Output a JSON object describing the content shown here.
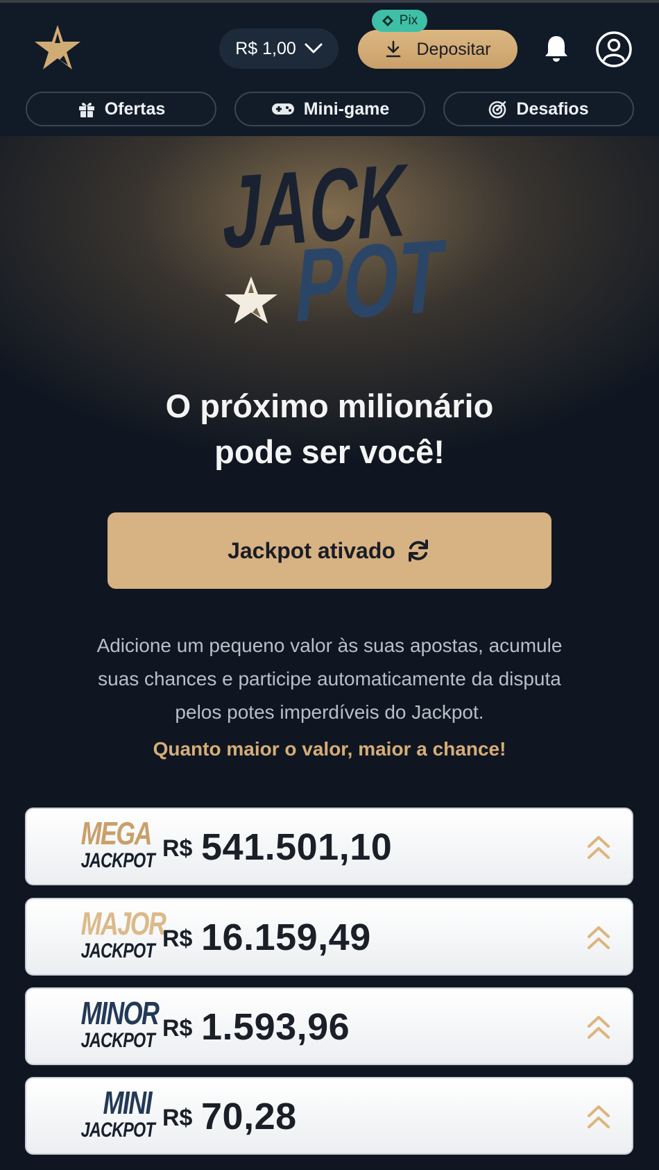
{
  "header": {
    "balance": "R$ 1,00",
    "pix_badge": "Pix",
    "deposit_label": "Depositar"
  },
  "nav": {
    "items": [
      {
        "label": "Ofertas",
        "icon": "gift-icon"
      },
      {
        "label": "Mini-game",
        "icon": "gamepad-icon"
      },
      {
        "label": "Desafios",
        "icon": "target-icon"
      }
    ]
  },
  "hero": {
    "logo_words": [
      "JACK",
      "POT"
    ],
    "headline_line1": "O próximo milionário",
    "headline_line2": "pode ser você!",
    "cta_label": "Jackpot ativado",
    "description_lines": [
      "Adicione um pequeno valor às suas apostas, acumule",
      "suas chances e participe automaticamente da disputa",
      "pelos potes imperdíveis do Jackpot."
    ],
    "highlight": "Quanto maior o valor, maior a chance!"
  },
  "jackpots": [
    {
      "tier": "MEGA",
      "sub": "JACKPOT",
      "currency": "R$",
      "amount": "541.501,10",
      "tier_color": "#c9a06a"
    },
    {
      "tier": "MAJOR",
      "sub": "JACKPOT",
      "currency": "R$",
      "amount": "16.159,49",
      "tier_color": "#dcb98a"
    },
    {
      "tier": "MINOR",
      "sub": "JACKPOT",
      "currency": "R$",
      "amount": "1.593,96",
      "tier_color": "#233a57"
    },
    {
      "tier": "MINI",
      "sub": "JACKPOT",
      "currency": "R$",
      "amount": "70,28",
      "tier_color": "#233a57"
    }
  ],
  "colors": {
    "accent_gold": "#d7b283",
    "background": "#0f1621",
    "pix_green": "#3fbfa6"
  }
}
